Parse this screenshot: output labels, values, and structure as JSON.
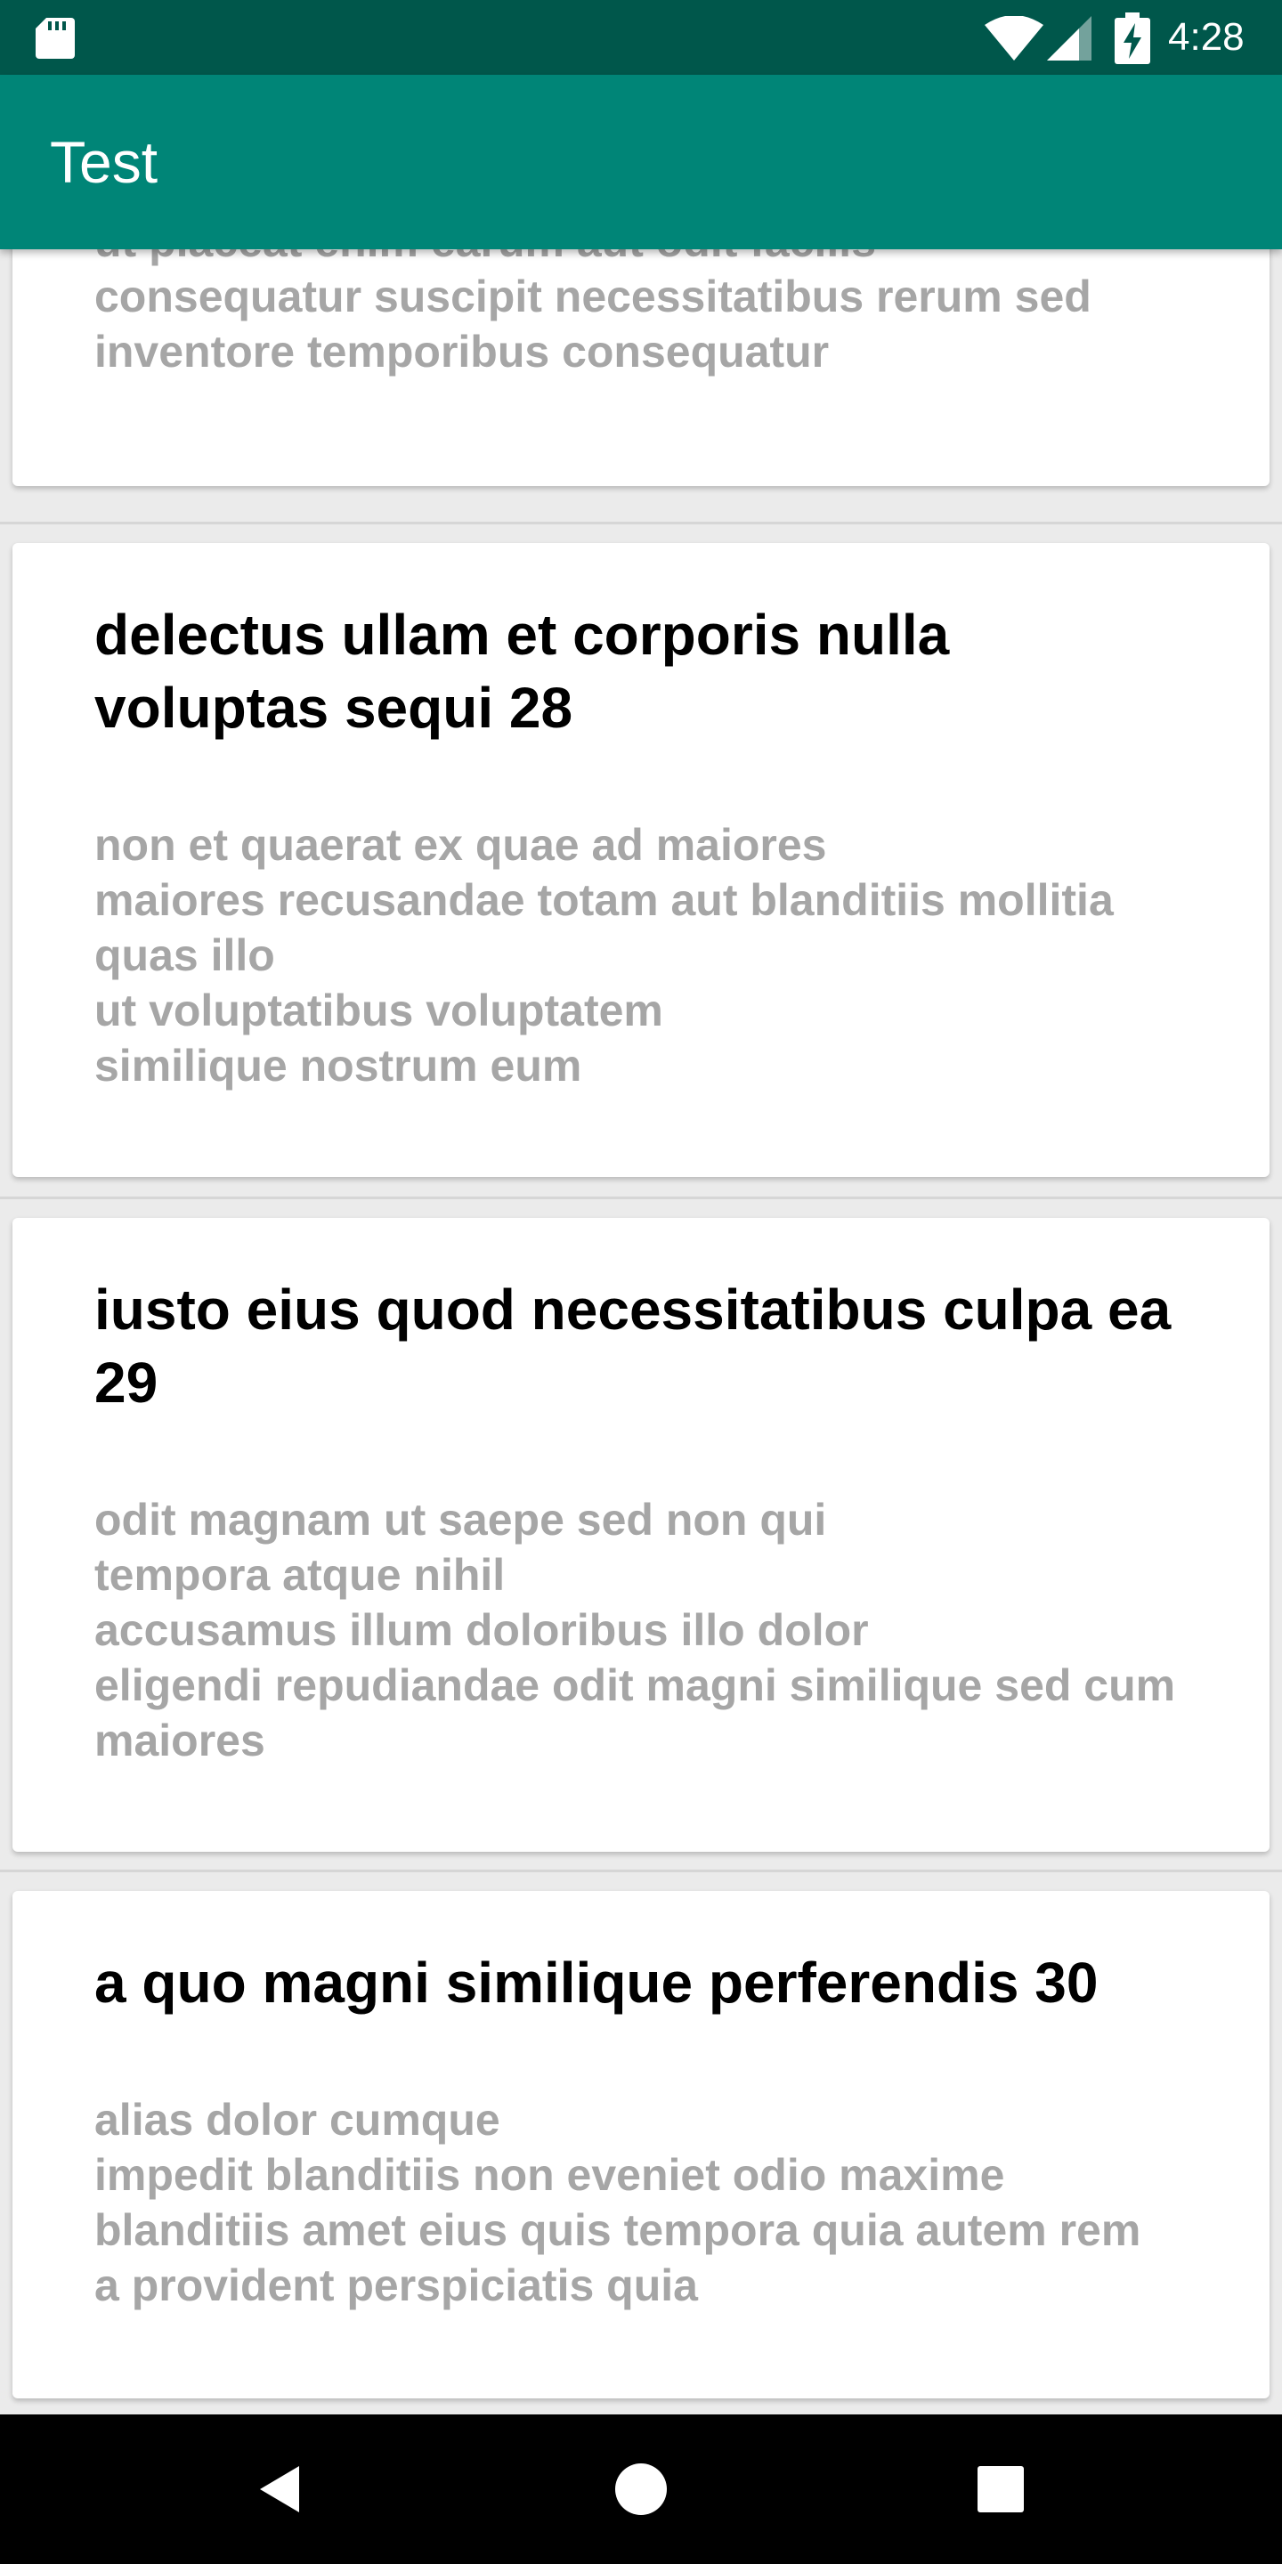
{
  "status_bar": {
    "time": "4:28",
    "icons": [
      "sd-card-icon",
      "wifi-icon",
      "signal-icon",
      "battery-charging-icon"
    ]
  },
  "app_bar": {
    "title": "Test"
  },
  "cards": [
    {
      "title": "",
      "body": [
        "ut placeat enim earum aut odit facilis",
        "consequatur suscipit necessitatibus rerum sed",
        "inventore temporibus consequatur"
      ]
    },
    {
      "title": "delectus ullam et corporis nulla voluptas sequi 28",
      "body": [
        "non et quaerat ex quae ad maiores",
        "maiores recusandae totam aut blanditiis mollitia",
        "quas illo",
        "ut voluptatibus voluptatem",
        "similique nostrum eum"
      ]
    },
    {
      "title": "iusto eius quod necessitatibus culpa ea 29",
      "body": [
        "odit magnam ut saepe sed non qui",
        "tempora atque nihil",
        "accusamus illum doloribus illo dolor",
        "eligendi repudiandae odit magni similique sed cum",
        "maiores"
      ]
    },
    {
      "title": "a quo magni similique perferendis 30",
      "body": [
        "alias dolor cumque",
        "impedit blanditiis non eveniet odio maxime",
        "blanditiis amet eius quis tempora quia autem rem",
        "a provident perspiciatis quia"
      ]
    }
  ],
  "nav_bar": {
    "buttons": [
      "back-icon",
      "home-icon",
      "recents-icon"
    ]
  },
  "colors": {
    "status_bar": "#00574b",
    "app_bar": "#008577",
    "background": "#ebebeb",
    "card": "#ffffff",
    "title_text": "#000000",
    "body_text": "#a6a6a6",
    "nav_bar": "#000000"
  }
}
